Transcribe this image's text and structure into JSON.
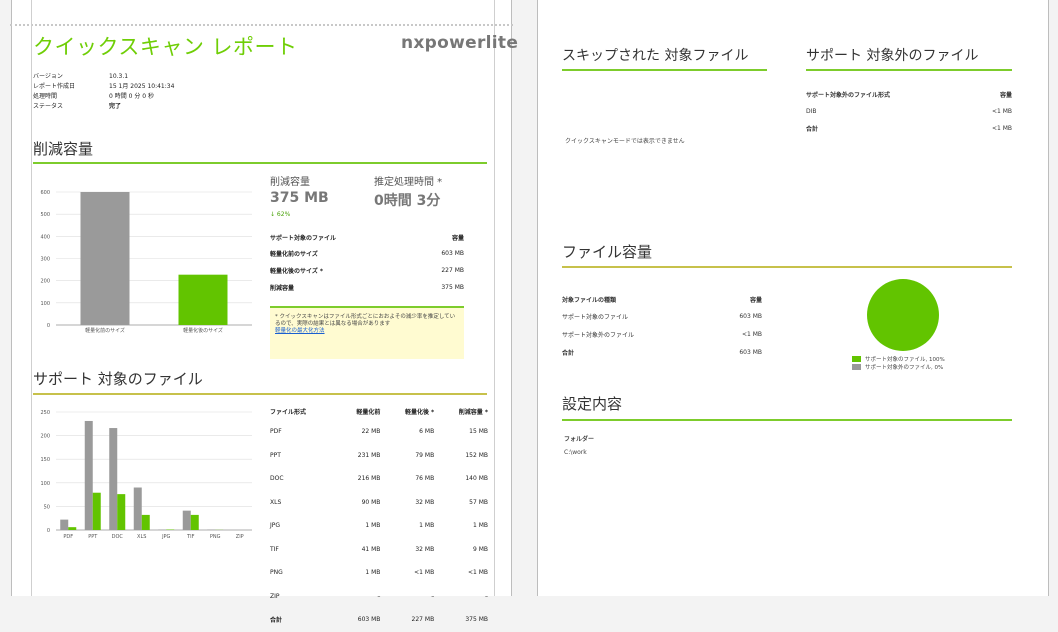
{
  "page1": {
    "title": "クイックスキャン レポート",
    "brand": "nxpowerlite",
    "meta": [
      {
        "label": "バージョン",
        "value": "10.3.1"
      },
      {
        "label": "レポート作成日",
        "value": "15 1月 2025 10:41:34"
      },
      {
        "label": "処理時間",
        "value": "0 時間 0 分 0 秒"
      },
      {
        "label": "ステータス",
        "value": "完了"
      }
    ],
    "reduction": {
      "section_title": "削減容量",
      "saved_label": "削減容量",
      "saved_value": "375 MB",
      "saved_percent": "↓ 62%",
      "time_label": "推定処理時間 *",
      "time_value": "0時間 3分",
      "table_head_left": "サポート対象のファイル",
      "table_head_right": "容量",
      "rows": [
        {
          "label": "軽量化前のサイズ",
          "value": "603 MB"
        },
        {
          "label": "軽量化後のサイズ *",
          "value": "227 MB"
        },
        {
          "label": "削減容量",
          "value": "375 MB"
        }
      ],
      "note_text": "* クイックスキャンはファイル形式ごとにおおよその減少率を推定しているので、実際の結果とは異なる場合があります",
      "note_link": "軽量化の最大化方法"
    },
    "supported_section_title": "サポート 対象のファイル",
    "types_table": {
      "headers": [
        "ファイル形式",
        "軽量化前",
        "軽量化後 *",
        "削減容量 *"
      ],
      "rows": [
        [
          "PDF",
          "22 MB",
          "6 MB",
          "15 MB"
        ],
        [
          "PPT",
          "231 MB",
          "79 MB",
          "152 MB"
        ],
        [
          "DOC",
          "216 MB",
          "76 MB",
          "140 MB"
        ],
        [
          "XLS",
          "90 MB",
          "32 MB",
          "57 MB"
        ],
        [
          "JPG",
          "1 MB",
          "1 MB",
          "1 MB"
        ],
        [
          "TIF",
          "41 MB",
          "32 MB",
          "9 MB"
        ],
        [
          "PNG",
          "1 MB",
          "<1 MB",
          "<1 MB"
        ],
        [
          "ZIP",
          "–",
          "–",
          "–"
        ],
        [
          "合計",
          "603 MB",
          "227 MB",
          "375 MB"
        ]
      ]
    }
  },
  "page2": {
    "skipped_title": "スキップされた 対象ファイル",
    "skipped_message": "クイックスキャンモードでは表示できません",
    "unsupported_title": "サポート 対象外のファイル",
    "unsupported_head_left": "サポート対象外のファイル形式",
    "unsupported_head_right": "容量",
    "unsupported_rows": [
      {
        "label": "DIB",
        "value": "<1 MB"
      },
      {
        "label": "合計",
        "value": "<1 MB"
      }
    ],
    "file_size_title": "ファイル容量",
    "file_size_head_left": "対象ファイルの種類",
    "file_size_head_right": "容量",
    "file_size_rows": [
      {
        "label": "サポート対象のファイル",
        "value": "603 MB"
      },
      {
        "label": "サポート対象外のファイル",
        "value": "<1 MB"
      },
      {
        "label": "合計",
        "value": "603 MB"
      }
    ],
    "legend": [
      {
        "label": "サポート対象のファイル, 100%",
        "color": "#62c400"
      },
      {
        "label": "サポート対象外のファイル, 0%",
        "color": "#999999"
      }
    ],
    "settings_title": "設定内容",
    "folder_label": "フォルダー",
    "folder_value": "C:\\work"
  },
  "colors": {
    "green": "#62c400",
    "gray": "#9a9a9a",
    "title_green": "#6fce06",
    "rule_green": "#7dcc2c",
    "rule_olive": "#c7c14b"
  },
  "chart_data": [
    {
      "type": "bar",
      "categories": [
        "軽量化前のサイズ",
        "軽量化後のサイズ"
      ],
      "series": [
        {
          "values": [
            603,
            227
          ],
          "colors": [
            "#9a9a9a",
            "#62c400"
          ]
        }
      ],
      "ylim": [
        0,
        600
      ],
      "yticks": [
        "0",
        "100",
        "200",
        "300",
        "400",
        "500",
        "600"
      ],
      "grid": true
    },
    {
      "type": "bar",
      "categories": [
        "PDF",
        "PPT",
        "DOC",
        "XLS",
        "JPG",
        "TIF",
        "PNG",
        "ZIP"
      ],
      "series": [
        {
          "values": [
            22,
            231,
            216,
            90,
            1,
            41,
            1,
            0
          ],
          "color": "#9a9a9a"
        },
        {
          "values": [
            6,
            79,
            76,
            32,
            1,
            32,
            0.3,
            0
          ],
          "color": "#62c400"
        }
      ],
      "ylim": [
        0,
        250
      ],
      "yticks": [
        "0",
        "50",
        "100",
        "150",
        "200",
        "250"
      ],
      "grid": true
    },
    {
      "type": "pie",
      "labels": [
        "サポート対象のファイル",
        "サポート対象外のファイル"
      ],
      "values": [
        100,
        0
      ],
      "colors": [
        "#62c400",
        "#999999"
      ]
    }
  ]
}
